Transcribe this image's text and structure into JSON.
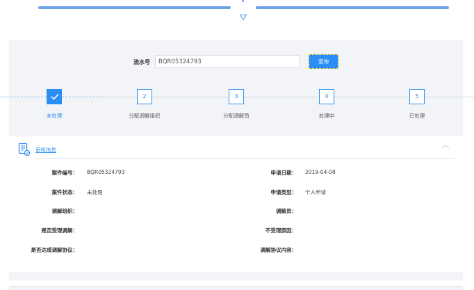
{
  "search": {
    "label": "流水号",
    "value": "BQR05324793",
    "button_label": "查询"
  },
  "steps": [
    {
      "number": "",
      "label": "未处理",
      "status": "done"
    },
    {
      "number": "2",
      "label": "分配调解组织",
      "status": "todo"
    },
    {
      "number": "3",
      "label": "分配调解员",
      "status": "todo"
    },
    {
      "number": "4",
      "label": "处理中",
      "status": "todo"
    },
    {
      "number": "5",
      "label": "已处理",
      "status": "todo"
    }
  ],
  "card": {
    "title": "审核信息",
    "fields": {
      "case_no_label": "案件编号：",
      "case_no_value": "BQR05324793",
      "apply_date_label": "申请日期：",
      "apply_date_value": "2019-04-08",
      "case_status_label": "案件状态：",
      "case_status_value": "未处理",
      "apply_type_label": "申请类型：",
      "apply_type_value": "个人申请",
      "mediation_org_label": "调解组织：",
      "mediation_org_value": "",
      "mediator_label": "调解员：",
      "mediator_value": "",
      "accepted_label": "是否受理调解：",
      "accepted_value": "",
      "reject_reason_label": "不受理原因：",
      "reject_reason_value": "",
      "agreement_reached_label": "是否达成调解协议：",
      "agreement_reached_value": "",
      "agreement_content_label": "调解协议内容：",
      "agreement_content_value": ""
    }
  },
  "colors": {
    "accent": "#2b8ef5",
    "panel_bg": "#f2f4f7",
    "header_line": "#6aa2e8"
  },
  "icons": {
    "check": "check-icon",
    "document": "document-audit-icon",
    "collapse": "chevron-up-icon",
    "expand": "chevron-down-icon"
  }
}
